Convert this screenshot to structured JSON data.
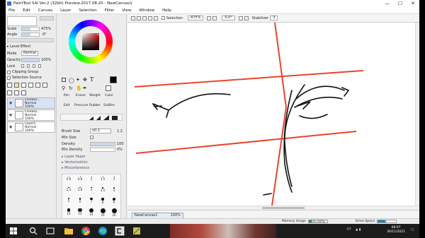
{
  "window": {
    "title": "PaintTool SAI Ver.2 (32bit) Preview.2017.08.20 - NewCanvas1",
    "minimize_glyph": "—",
    "maximize_glyph": "☐",
    "close_glyph": "✕"
  },
  "menu": [
    "File",
    "Edit",
    "Canvas",
    "Layer",
    "Selection",
    "Filter",
    "View",
    "Window",
    "Help"
  ],
  "left_panel": {
    "scale": {
      "label": "Scale",
      "value": "475%",
      "fill": 0.5
    },
    "angle": {
      "label": "Angle",
      "value": "0°",
      "fill": 0.5
    },
    "level_effect": "Level Effect",
    "mode_label": "Mode",
    "mode_value": "Normal",
    "opacity": {
      "label": "Opacity",
      "value": "100%",
      "fill": 1.0
    },
    "lock_label": "Lock",
    "clipping_group": "Clipping Group",
    "selection_source": "Selection Source",
    "layers": [
      {
        "name": "Linewor...",
        "mode": "Normal",
        "opacity": "100%"
      },
      {
        "name": "Linewor...",
        "mode": "Normal",
        "opacity": "100%"
      },
      {
        "name": "Layer1",
        "mode": "Normal",
        "opacity": "100%"
      }
    ]
  },
  "tool_panel": {
    "tools_row1": [
      "Pen",
      "Eraser",
      "Weight",
      "Color"
    ],
    "tools_row2": [
      "Edit",
      "Pressure",
      "Rubber",
      "SailBre"
    ],
    "brush_size": {
      "label": "Brush Size",
      "mult": "x0.1",
      "value": "1.2"
    },
    "min_size": {
      "label": "Min Size"
    },
    "density": {
      "label": "Density",
      "value": "100"
    },
    "min_density": {
      "label": "Min Density",
      "value": "0%"
    },
    "sections": [
      "Layer Paper",
      "Vectorization",
      "Miscellaneous"
    ],
    "size_presets": [
      "0.6",
      "0.8",
      "1",
      "1.5",
      "2",
      "2.3",
      "2.6",
      "3",
      "3.5",
      "4",
      "5",
      "6",
      "7",
      "8",
      "9",
      "10",
      "12",
      "14",
      "16",
      "20"
    ]
  },
  "canvas_toolbar": {
    "selection_label": "Selection",
    "zoom": "475%",
    "angle": "0.0°",
    "stabilizer_label": "Stabilizer",
    "stabilizer_value": "3"
  },
  "navigator": {
    "doc_name": "NewCanvas1",
    "zoom": "100%"
  },
  "status": {
    "memory_label": "Memory Usage",
    "memory_value": "15% (16%)",
    "memory_fraction": 0.15,
    "drive_label": "Drive Space",
    "drive_value": "45%",
    "drive_fraction": 0.45
  },
  "taskbar": {
    "clock_time": "08:07",
    "clock_date": "30/11/2021",
    "lang": "PT",
    "colors": {
      "bg": "#1c1c1c"
    }
  },
  "colors": {
    "guide_line": "#e8442a",
    "ink": "#111111",
    "accent": "#3a6fd8",
    "memory_fill": "#2fb05a",
    "drive_fill": "#3aa0e0"
  }
}
